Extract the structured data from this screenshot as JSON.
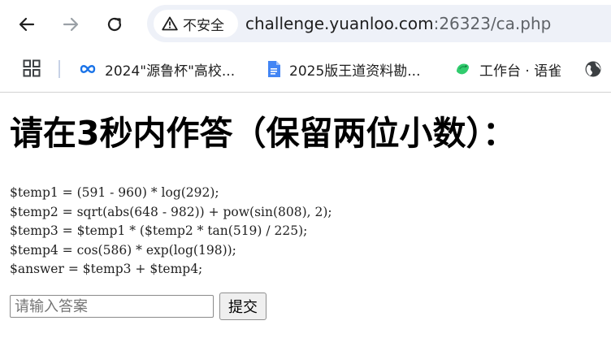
{
  "browser": {
    "security_label": "不安全",
    "url_host": "challenge.yuanloo.com",
    "url_rest": ":26323/ca.php",
    "icons": {
      "back": "back-arrow-icon",
      "forward": "forward-arrow-icon",
      "reload": "reload-icon",
      "security": "warning-triangle-icon"
    },
    "colors": {
      "omnibox_bg": "#eef1f8",
      "forward_disabled": "#9aa0a6"
    }
  },
  "bookmarks": {
    "items": [
      {
        "label": "2024\"源鲁杯\"高校...",
        "icon": "infinity-link-icon"
      },
      {
        "label": "2025版王道资料勘...",
        "icon": "google-docs-icon"
      },
      {
        "label": "工作台 · 语雀",
        "icon": "yuque-bird-icon"
      }
    ],
    "extra_icon": "globe-icon"
  },
  "page": {
    "heading": "请在3秒内作答（保留两位小数）：",
    "code_lines": [
      "$temp1 = (591 - 960) * log(292);",
      "$temp2 = sqrt(abs(648 - 982)) + pow(sin(808), 2);",
      "$temp3 = $temp1 * ($temp2 * tan(519) / 225);",
      "$temp4 = cos(586) * exp(log(198));",
      "$answer = $temp3 + $temp4;"
    ],
    "answer_placeholder": "请输入答案",
    "answer_value": "",
    "submit_label": "提交"
  }
}
